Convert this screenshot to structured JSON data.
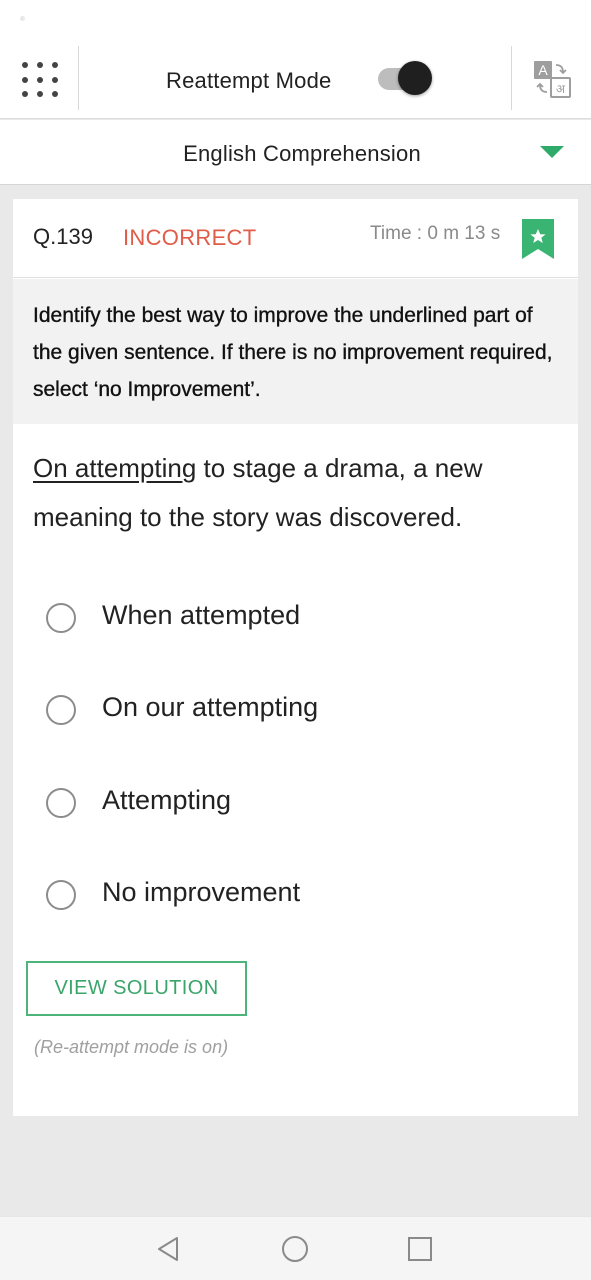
{
  "header": {
    "mode_label": "Reattempt Mode",
    "toggle_on": true
  },
  "subject": {
    "label": "English Comprehension"
  },
  "question": {
    "number": "Q.139",
    "status": "INCORRECT",
    "time": "Time : 0 m 13 s",
    "instruction": "Identify the best way to improve the underlined part of the given sentence. If there is no improvement required, select ‘no Improvement’.",
    "sentence_underlined": "On attempting",
    "sentence_rest": " to stage a drama, a new meaning to the story was discovered.",
    "options": [
      {
        "label": "When attempted"
      },
      {
        "label": "On our attempting"
      },
      {
        "label": "Attempting"
      },
      {
        "label": "No improvement"
      }
    ],
    "view_solution_label": "VIEW SOLUTION",
    "reattempt_note": "(Re-attempt mode is on)"
  },
  "icons": {
    "menu": "grid-menu-icon",
    "translate": "translate-icon",
    "bookmark": "bookmark-star-icon",
    "back": "nav-back-icon",
    "home": "nav-home-icon",
    "recents": "nav-recents-icon"
  },
  "colors": {
    "accent_green": "#2eaa6a",
    "incorrect_red": "#e05b48",
    "button_border": "#4db57a"
  }
}
